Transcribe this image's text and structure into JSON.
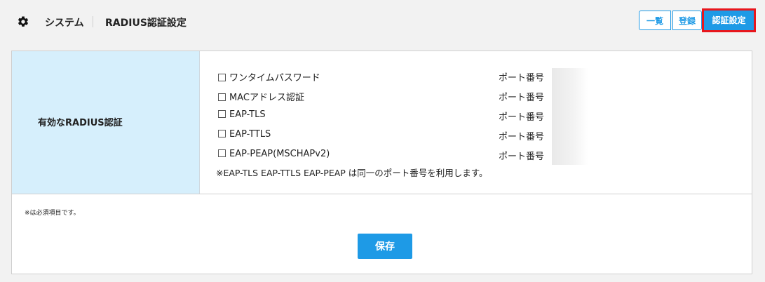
{
  "header": {
    "title_system": "システム",
    "title_page": "RADIUS認証設定",
    "gear_icon": "gear-icon"
  },
  "tabs": {
    "list_label": "一覧",
    "register_label": "登録",
    "auth_label": "認証設定"
  },
  "form": {
    "row_label": "有効なRADIUS認証",
    "options": [
      {
        "label": "ワンタイムパスワード",
        "port_label": "ポート番号"
      },
      {
        "label": "MACアドレス認証",
        "port_label": "ポート番号"
      },
      {
        "label": "EAP-TLS",
        "port_label": "ポート番号"
      },
      {
        "label": "EAP-TTLS",
        "port_label": "ポート番号"
      },
      {
        "label": "EAP-PEAP(MSCHAPv2)",
        "port_label": "ポート番号"
      }
    ],
    "note": "※EAP-TLS EAP-TTLS EAP-PEAP は同一のポート番号を利用します。"
  },
  "footer": {
    "required_note": "※は必須項目です。",
    "save_label": "保存"
  },
  "colors": {
    "accent": "#1e9ae6",
    "label_bg": "#d6effc",
    "highlight_border": "#e8161c"
  }
}
